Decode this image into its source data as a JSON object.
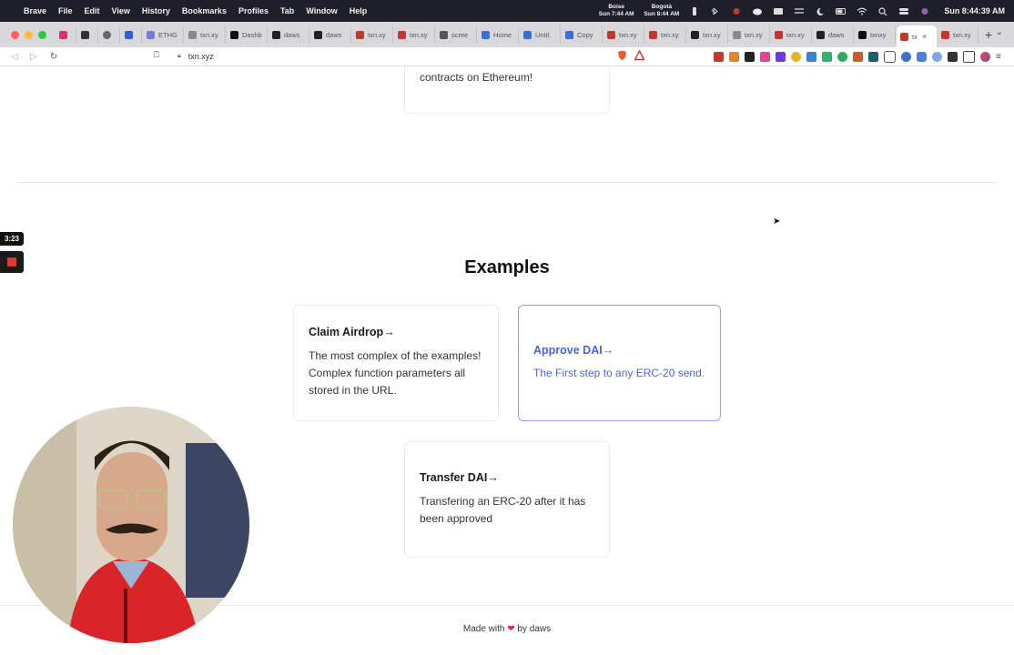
{
  "menubar": {
    "app_name": "Brave",
    "items": [
      "File",
      "Edit",
      "View",
      "History",
      "Bookmarks",
      "Profiles",
      "Tab",
      "Window",
      "Help"
    ],
    "clock_boise_city": "Boise",
    "clock_boise_time": "Sun 7:44 AM",
    "clock_bogota_city": "Bogotá",
    "clock_bogota_time": "Sun 8:44 AM",
    "datetime": "Sun 8:44:39 AM"
  },
  "tabs": [
    {
      "label": "ETHG",
      "color": "#7b7bd6"
    },
    {
      "label": "txn.xy",
      "color": "#8a8a8a"
    },
    {
      "label": "Dashb",
      "color": "#111111"
    },
    {
      "label": "daws",
      "color": "#222222"
    },
    {
      "label": "daws",
      "color": "#222222"
    },
    {
      "label": "txn.xy",
      "color": "#c0392b"
    },
    {
      "label": "txn.xy",
      "color": "#c0392b"
    },
    {
      "label": "scree",
      "color": "#555555"
    },
    {
      "label": "Home",
      "color": "#3b6fd6"
    },
    {
      "label": "Untit",
      "color": "#3b6fd6"
    },
    {
      "label": "Copy",
      "color": "#3b6fd6"
    },
    {
      "label": "txn.xy",
      "color": "#c0392b"
    },
    {
      "label": "txn.xy",
      "color": "#c0392b"
    },
    {
      "label": "txn.xy",
      "color": "#222222"
    },
    {
      "label": "txn.xy",
      "color": "#8a8a8a"
    },
    {
      "label": "txn.xy",
      "color": "#c0392b"
    },
    {
      "label": "daws",
      "color": "#222222"
    },
    {
      "label": "txnxy",
      "color": "#111111"
    }
  ],
  "active_tab": {
    "label": "tx",
    "color": "#c0392b"
  },
  "last_tab": {
    "label": "txn.xy",
    "color": "#c0392b"
  },
  "toolbar": {
    "url": "txn.xyz"
  },
  "page": {
    "top_card_desc": "contracts on Ethereum!",
    "heading": "Examples",
    "cards": [
      {
        "title": "Claim Airdrop→",
        "desc": "The most complex of the examples! Complex function parameters all stored in the URL."
      },
      {
        "title": "Approve DAI→",
        "desc": "The First step to any ERC-20 send."
      },
      {
        "title": "Transfer DAI→",
        "desc": "Transfering an ERC-20 after it has been approved"
      }
    ],
    "footer": {
      "prefix": "Made with",
      "heart": "❤",
      "suffix": "by daws"
    }
  },
  "recorder": {
    "timer": "3:23"
  }
}
